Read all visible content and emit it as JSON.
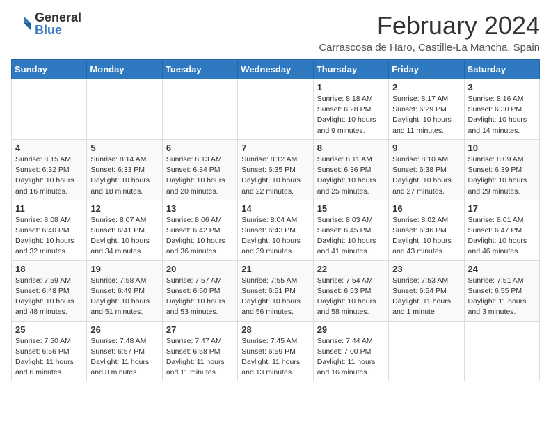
{
  "header": {
    "logo_general": "General",
    "logo_blue": "Blue",
    "title": "February 2024",
    "subtitle": "Carrascosa de Haro, Castille-La Mancha, Spain"
  },
  "weekdays": [
    "Sunday",
    "Monday",
    "Tuesday",
    "Wednesday",
    "Thursday",
    "Friday",
    "Saturday"
  ],
  "weeks": [
    [
      {
        "day": "",
        "info": ""
      },
      {
        "day": "",
        "info": ""
      },
      {
        "day": "",
        "info": ""
      },
      {
        "day": "",
        "info": ""
      },
      {
        "day": "1",
        "info": "Sunrise: 8:18 AM\nSunset: 6:28 PM\nDaylight: 10 hours\nand 9 minutes."
      },
      {
        "day": "2",
        "info": "Sunrise: 8:17 AM\nSunset: 6:29 PM\nDaylight: 10 hours\nand 11 minutes."
      },
      {
        "day": "3",
        "info": "Sunrise: 8:16 AM\nSunset: 6:30 PM\nDaylight: 10 hours\nand 14 minutes."
      }
    ],
    [
      {
        "day": "4",
        "info": "Sunrise: 8:15 AM\nSunset: 6:32 PM\nDaylight: 10 hours\nand 16 minutes."
      },
      {
        "day": "5",
        "info": "Sunrise: 8:14 AM\nSunset: 6:33 PM\nDaylight: 10 hours\nand 18 minutes."
      },
      {
        "day": "6",
        "info": "Sunrise: 8:13 AM\nSunset: 6:34 PM\nDaylight: 10 hours\nand 20 minutes."
      },
      {
        "day": "7",
        "info": "Sunrise: 8:12 AM\nSunset: 6:35 PM\nDaylight: 10 hours\nand 22 minutes."
      },
      {
        "day": "8",
        "info": "Sunrise: 8:11 AM\nSunset: 6:36 PM\nDaylight: 10 hours\nand 25 minutes."
      },
      {
        "day": "9",
        "info": "Sunrise: 8:10 AM\nSunset: 6:38 PM\nDaylight: 10 hours\nand 27 minutes."
      },
      {
        "day": "10",
        "info": "Sunrise: 8:09 AM\nSunset: 6:39 PM\nDaylight: 10 hours\nand 29 minutes."
      }
    ],
    [
      {
        "day": "11",
        "info": "Sunrise: 8:08 AM\nSunset: 6:40 PM\nDaylight: 10 hours\nand 32 minutes."
      },
      {
        "day": "12",
        "info": "Sunrise: 8:07 AM\nSunset: 6:41 PM\nDaylight: 10 hours\nand 34 minutes."
      },
      {
        "day": "13",
        "info": "Sunrise: 8:06 AM\nSunset: 6:42 PM\nDaylight: 10 hours\nand 36 minutes."
      },
      {
        "day": "14",
        "info": "Sunrise: 8:04 AM\nSunset: 6:43 PM\nDaylight: 10 hours\nand 39 minutes."
      },
      {
        "day": "15",
        "info": "Sunrise: 8:03 AM\nSunset: 6:45 PM\nDaylight: 10 hours\nand 41 minutes."
      },
      {
        "day": "16",
        "info": "Sunrise: 8:02 AM\nSunset: 6:46 PM\nDaylight: 10 hours\nand 43 minutes."
      },
      {
        "day": "17",
        "info": "Sunrise: 8:01 AM\nSunset: 6:47 PM\nDaylight: 10 hours\nand 46 minutes."
      }
    ],
    [
      {
        "day": "18",
        "info": "Sunrise: 7:59 AM\nSunset: 6:48 PM\nDaylight: 10 hours\nand 48 minutes."
      },
      {
        "day": "19",
        "info": "Sunrise: 7:58 AM\nSunset: 6:49 PM\nDaylight: 10 hours\nand 51 minutes."
      },
      {
        "day": "20",
        "info": "Sunrise: 7:57 AM\nSunset: 6:50 PM\nDaylight: 10 hours\nand 53 minutes."
      },
      {
        "day": "21",
        "info": "Sunrise: 7:55 AM\nSunset: 6:51 PM\nDaylight: 10 hours\nand 56 minutes."
      },
      {
        "day": "22",
        "info": "Sunrise: 7:54 AM\nSunset: 6:53 PM\nDaylight: 10 hours\nand 58 minutes."
      },
      {
        "day": "23",
        "info": "Sunrise: 7:53 AM\nSunset: 6:54 PM\nDaylight: 11 hours\nand 1 minute."
      },
      {
        "day": "24",
        "info": "Sunrise: 7:51 AM\nSunset: 6:55 PM\nDaylight: 11 hours\nand 3 minutes."
      }
    ],
    [
      {
        "day": "25",
        "info": "Sunrise: 7:50 AM\nSunset: 6:56 PM\nDaylight: 11 hours\nand 6 minutes."
      },
      {
        "day": "26",
        "info": "Sunrise: 7:48 AM\nSunset: 6:57 PM\nDaylight: 11 hours\nand 8 minutes."
      },
      {
        "day": "27",
        "info": "Sunrise: 7:47 AM\nSunset: 6:58 PM\nDaylight: 11 hours\nand 11 minutes."
      },
      {
        "day": "28",
        "info": "Sunrise: 7:45 AM\nSunset: 6:59 PM\nDaylight: 11 hours\nand 13 minutes."
      },
      {
        "day": "29",
        "info": "Sunrise: 7:44 AM\nSunset: 7:00 PM\nDaylight: 11 hours\nand 16 minutes."
      },
      {
        "day": "",
        "info": ""
      },
      {
        "day": "",
        "info": ""
      }
    ]
  ]
}
